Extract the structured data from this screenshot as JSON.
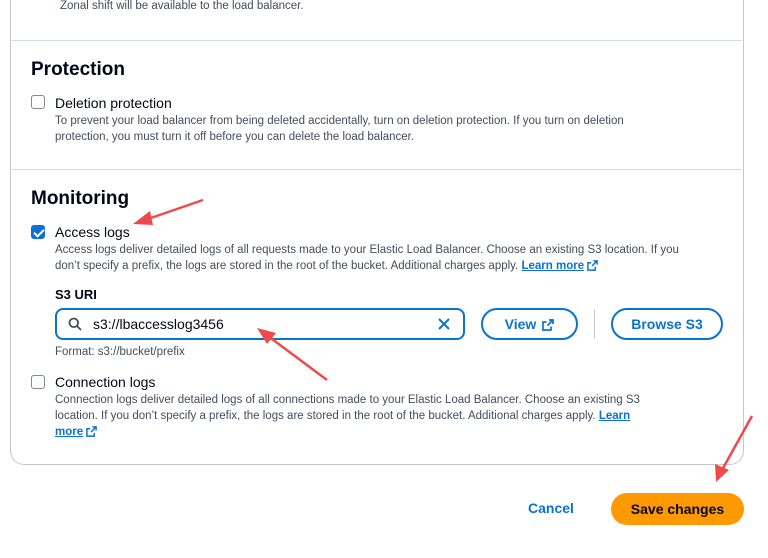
{
  "zonal": {
    "note": "Zonal shift will be available to the load balancer."
  },
  "protection": {
    "title": "Protection",
    "deletion": {
      "label": "Deletion protection",
      "checked": false,
      "desc1": "To prevent your load balancer from being deleted accidentally, turn on deletion protection. If you turn on deletion",
      "desc2": "protection, you must turn it off before you can delete the load balancer."
    }
  },
  "monitoring": {
    "title": "Monitoring",
    "access_logs": {
      "label": "Access logs",
      "checked": true,
      "desc1": "Access logs deliver detailed logs of all requests made to your Elastic Load Balancer. Choose an existing S3 location. If you",
      "desc2": "don’t specify a prefix, the logs are stored in the root of the bucket. Additional charges apply.",
      "learn_more": "Learn more"
    },
    "s3_uri": {
      "label": "S3 URI",
      "value": "s3://lbaccesslog3456",
      "format_hint": "Format: s3://bucket/prefix",
      "view_label": "View",
      "browse_label": "Browse S3"
    },
    "connection_logs": {
      "label": "Connection logs",
      "checked": false,
      "desc1": "Connection logs deliver detailed logs of all connections made to your Elastic Load Balancer. Choose an existing S3",
      "desc2": "location. If you don’t specify a prefix, the logs are stored in the root of the bucket. Additional charges apply.",
      "learn": "Learn",
      "more": "more"
    }
  },
  "footer": {
    "cancel_label": "Cancel",
    "save_label": "Save changes"
  },
  "colors": {
    "accent": "#0972d3",
    "primary_button": "#ff9900",
    "annotation_arrow": "#f0494b"
  }
}
